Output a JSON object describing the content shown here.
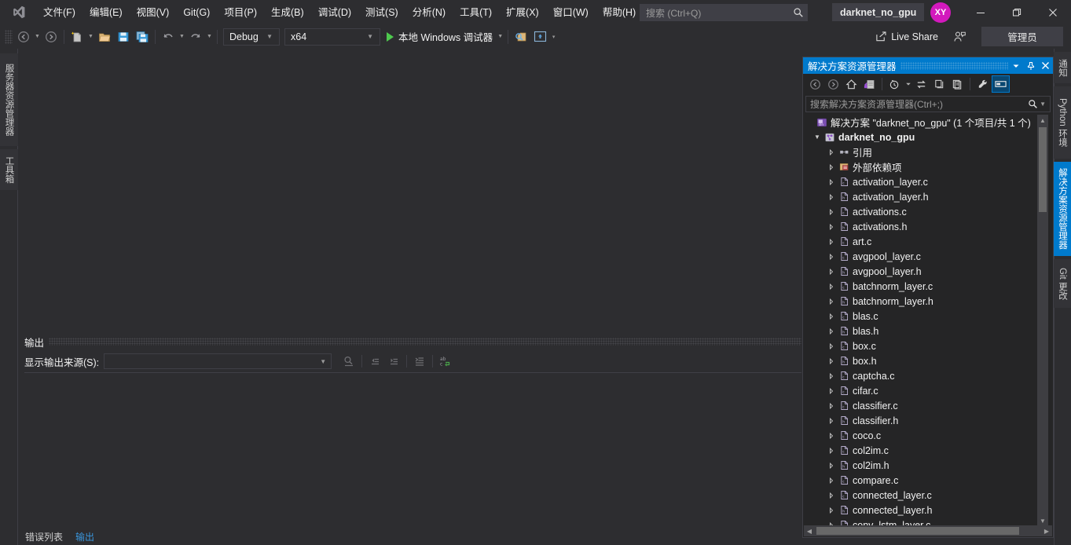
{
  "app": {
    "title": "darknet_no_gpu",
    "avatar_initials": "XY",
    "logo_name": "visual-studio-logo"
  },
  "menu": {
    "items": [
      {
        "label": "文件(F)"
      },
      {
        "label": "编辑(E)"
      },
      {
        "label": "视图(V)"
      },
      {
        "label": "Git(G)"
      },
      {
        "label": "项目(P)"
      },
      {
        "label": "生成(B)"
      },
      {
        "label": "调试(D)"
      },
      {
        "label": "测试(S)"
      },
      {
        "label": "分析(N)"
      },
      {
        "label": "工具(T)"
      },
      {
        "label": "扩展(X)"
      },
      {
        "label": "窗口(W)"
      },
      {
        "label": "帮助(H)"
      }
    ]
  },
  "quick_search": {
    "placeholder": "搜索 (Ctrl+Q)"
  },
  "window_controls": {
    "minimize": "—",
    "maximize": "❐",
    "close": "✕"
  },
  "toolbar": {
    "config": {
      "value": "Debug"
    },
    "platform": {
      "value": "x64"
    },
    "run": {
      "label": "本地 Windows 调试器"
    },
    "live_share": {
      "label": "Live Share"
    },
    "admin": {
      "label": "管理员"
    },
    "icons": {
      "back": "navigate-back-icon",
      "forward": "navigate-forward-icon",
      "new": "new-item-icon",
      "open": "open-file-icon",
      "save": "save-icon",
      "save_all": "save-all-icon",
      "undo": "undo-icon",
      "redo": "redo-icon",
      "find": "find-in-files-icon",
      "screenshot": "window-layout-icon",
      "overflow": "toolbar-overflow-icon",
      "share": "share-icon",
      "feedback": "send-feedback-icon"
    }
  },
  "left_dock": {
    "tabs": [
      {
        "label": "服务器资源管理器"
      },
      {
        "label": "工具箱"
      }
    ]
  },
  "right_dock": {
    "tabs": [
      {
        "label": "通知",
        "selected": false
      },
      {
        "label": "Python 环境",
        "selected": false
      },
      {
        "label": "解决方案资源管理器",
        "selected": true
      },
      {
        "label": "Git 更改",
        "selected": false
      }
    ]
  },
  "output_panel": {
    "title": "输出",
    "source_label": "显示输出来源(S):",
    "source_value": "",
    "body_text": "",
    "tool_icons": [
      "find-message-icon",
      "go-to-previous-message-icon",
      "go-to-next-message-icon",
      "clear-all-icon",
      "toggle-word-wrap-icon"
    ]
  },
  "bottom_tabs": {
    "items": [
      {
        "label": "错误列表",
        "active": false
      },
      {
        "label": "输出",
        "active": true
      }
    ]
  },
  "solution_explorer": {
    "title": "解决方案资源管理器",
    "header_buttons": {
      "dropdown": "chevron-down-icon",
      "pin": "pin-icon",
      "close": "close-icon"
    },
    "toolbar_icons": [
      "navigate-back-icon",
      "navigate-forward-icon",
      "home-icon",
      "switch-views-icon",
      "pending-changes-filter-icon",
      "sync-with-active-document-icon",
      "refresh-icon",
      "collapse-all-icon",
      "show-all-files-icon",
      "properties-icon",
      "preview-selected-items-icon"
    ],
    "search": {
      "placeholder": "搜索解决方案资源管理器(Ctrl+;)"
    },
    "solution_node": {
      "label": "解决方案 \"darknet_no_gpu\" (1 个项目/共 1 个)",
      "icon": "solution-icon"
    },
    "project_node": {
      "label": "darknet_no_gpu",
      "icon": "cpp-project-icon"
    },
    "tree": [
      {
        "label": "引用",
        "icon": "references-icon",
        "indent": 1
      },
      {
        "label": "外部依赖项",
        "icon": "external-dependencies-icon",
        "indent": 1
      },
      {
        "label": "activation_layer.c",
        "icon": "c-file-icon",
        "indent": 1
      },
      {
        "label": "activation_layer.h",
        "icon": "h-file-icon",
        "indent": 1
      },
      {
        "label": "activations.c",
        "icon": "c-file-icon",
        "indent": 1
      },
      {
        "label": "activations.h",
        "icon": "h-file-icon",
        "indent": 1
      },
      {
        "label": "art.c",
        "icon": "c-file-icon",
        "indent": 1
      },
      {
        "label": "avgpool_layer.c",
        "icon": "c-file-icon",
        "indent": 1
      },
      {
        "label": "avgpool_layer.h",
        "icon": "h-file-icon",
        "indent": 1
      },
      {
        "label": "batchnorm_layer.c",
        "icon": "c-file-icon",
        "indent": 1
      },
      {
        "label": "batchnorm_layer.h",
        "icon": "h-file-icon",
        "indent": 1
      },
      {
        "label": "blas.c",
        "icon": "c-file-icon",
        "indent": 1
      },
      {
        "label": "blas.h",
        "icon": "h-file-icon",
        "indent": 1
      },
      {
        "label": "box.c",
        "icon": "c-file-icon",
        "indent": 1
      },
      {
        "label": "box.h",
        "icon": "h-file-icon",
        "indent": 1
      },
      {
        "label": "captcha.c",
        "icon": "c-file-icon",
        "indent": 1
      },
      {
        "label": "cifar.c",
        "icon": "c-file-icon",
        "indent": 1
      },
      {
        "label": "classifier.c",
        "icon": "c-file-icon",
        "indent": 1
      },
      {
        "label": "classifier.h",
        "icon": "h-file-icon",
        "indent": 1
      },
      {
        "label": "coco.c",
        "icon": "c-file-icon",
        "indent": 1
      },
      {
        "label": "col2im.c",
        "icon": "c-file-icon",
        "indent": 1
      },
      {
        "label": "col2im.h",
        "icon": "h-file-icon",
        "indent": 1
      },
      {
        "label": "compare.c",
        "icon": "c-file-icon",
        "indent": 1
      },
      {
        "label": "connected_layer.c",
        "icon": "c-file-icon",
        "indent": 1
      },
      {
        "label": "connected_layer.h",
        "icon": "h-file-icon",
        "indent": 1
      },
      {
        "label": "conv_lstm_layer.c",
        "icon": "c-file-icon",
        "indent": 1
      }
    ]
  },
  "colors": {
    "accent": "#007acc",
    "chrome_bg": "#2d2d30",
    "panel_bg": "#252526",
    "border": "#3f3f46",
    "text": "#f1f1f1",
    "avatar": "#d319bd",
    "run_green": "#4ec94e",
    "active_tab_text": "#3a96dd"
  }
}
